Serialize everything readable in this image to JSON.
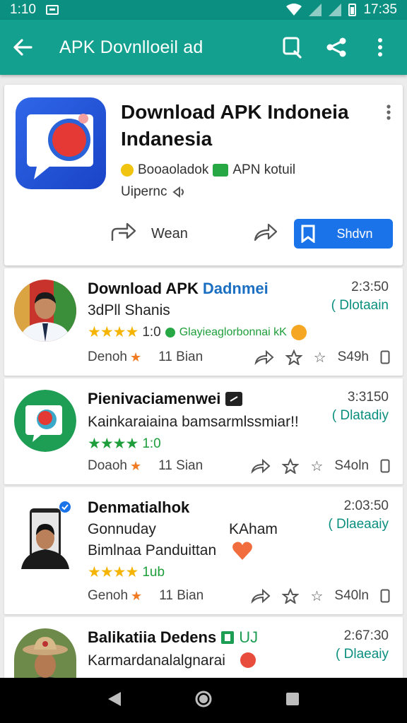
{
  "status_bar": {
    "time_left": "1:10",
    "time_right": "17:35"
  },
  "app_bar": {
    "title": "APK Dovnlloeil ad"
  },
  "top_card": {
    "title_line1": "Download APK Indoneia",
    "title_line2": "Indanesia",
    "meta_left": "Booaoladok",
    "meta_right": "APN kotuil",
    "meta_line2": "Uipernc",
    "action_label": "Wean",
    "primary_button": "Shdvn"
  },
  "items": [
    {
      "title": "Download APK ",
      "title_accent": "Dadnmei",
      "subtitle": "3dPll Shanis",
      "time": "2:3:50",
      "status": "( Dlotaain",
      "stars": "★★★★",
      "rating_text": "1:0",
      "extra_text": "Glayieaglorbonnai kK",
      "footer_left": "Denoh",
      "footer_mid": "11 Bian",
      "footer_count": "S49h"
    },
    {
      "title": "Pienivaciamenwei",
      "subtitle": "Kainkaraiaina bamsarmlssmiar!!",
      "time": "3:3150",
      "status": "( Dlatadiy",
      "stars": "★★★★",
      "rating_text": "1:0",
      "footer_left": "Doaoh",
      "footer_mid": "11 Sian",
      "footer_count": "S4oln"
    },
    {
      "title": "Denmatialhok",
      "subtitle": "Gonnuday",
      "subtitle_right": "KAham",
      "subtitle2": "Bimlnaa Panduittan",
      "time": "2:03:50",
      "status": "( Dlaeaaiy",
      "stars": "★★★★",
      "rating_text": "1ub",
      "footer_left": "Genoh",
      "footer_mid": "11 Bian",
      "footer_count": "S40ln"
    },
    {
      "title": "Balikatiia Dedens",
      "title_suffix": "UJ",
      "subtitle": "Karmardanalalgnarai",
      "time": "2:67:30",
      "status": "( Dlaeaiy"
    }
  ],
  "icons": {
    "back": "arrow-left-icon",
    "search": "search-icon",
    "share": "share-icon",
    "menu": "more-vert-icon"
  },
  "colors": {
    "appbar": "#14a08f",
    "statusbar": "#0b8f80",
    "primary": "#1a73e8",
    "star": "#f4b400",
    "status_text": "#0a8f7e"
  }
}
